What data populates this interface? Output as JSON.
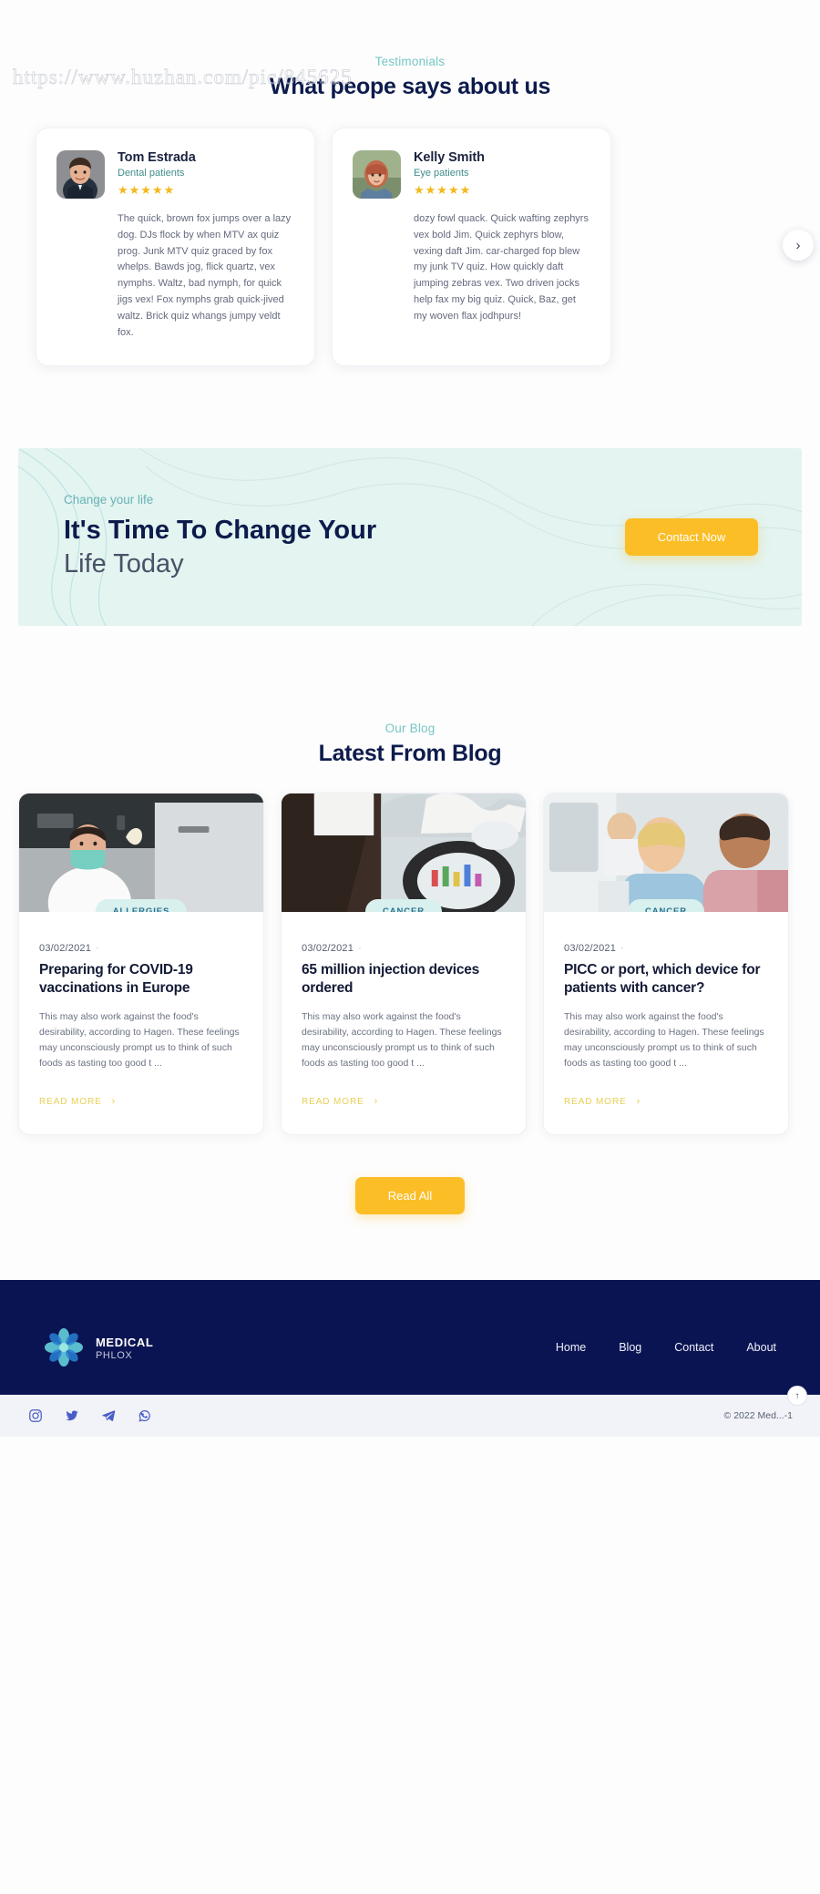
{
  "watermark": "https://www.huzhan.com/pic/845625",
  "testimonials": {
    "eyebrow": "Testimonials",
    "title": "What peope says about us",
    "next_label": "›",
    "cards": [
      {
        "name": "Tom Estrada",
        "role": "Dental patients",
        "stars": "★★★★★",
        "text": "The quick, brown fox jumps over a lazy dog. DJs flock by when MTV ax quiz prog. Junk MTV quiz graced by fox whelps. Bawds jog, flick quartz, vex nymphs. Waltz, bad nymph, for quick jigs vex! Fox nymphs grab quick-jived waltz. Brick quiz whangs jumpy veldt fox."
      },
      {
        "name": "Kelly Smith",
        "role": "Eye patients",
        "stars": "★★★★★",
        "text": "dozy fowl quack. Quick wafting zephyrs vex bold Jim. Quick zephyrs blow, vexing daft Jim. car-charged fop blew my junk TV quiz. How quickly daft jumping zebras vex. Two driven jocks help fax my big quiz. Quick, Baz, get my woven flax jodhpurs!"
      }
    ]
  },
  "cta": {
    "eyebrow": "Change your life",
    "title_strong": "It's Time To Change Your",
    "title_light": "Life Today",
    "button": "Contact Now",
    "bg_color": "#e3f4f1",
    "accent_color": "#fbbe26"
  },
  "blog": {
    "eyebrow": "Our Blog",
    "title": "Latest From Blog",
    "read_all": "Read All",
    "read_more": "READ MORE",
    "chevron": "›",
    "posts": [
      {
        "category": "ALLERGIES",
        "date": "03/02/2021",
        "title": "Preparing for COVID-19 vaccinations in Europe",
        "excerpt": "This may also work against the food's desirability, according to Hagen. These feelings may unconsciously prompt us to think of such foods as tasting too good t ..."
      },
      {
        "category": "CANCER",
        "date": "03/02/2021",
        "title": "65 million injection devices ordered",
        "excerpt": "This may also work against the food's desirability, according to Hagen. These feelings may unconsciously prompt us to think of such foods as tasting too good t ..."
      },
      {
        "category": "CANCER",
        "date": "03/02/2021",
        "title": "PICC or port, which device for patients with cancer?",
        "excerpt": "This may also work against the food's desirability, according to Hagen. These feelings may unconsciously prompt us to think of such foods as tasting too good t ..."
      }
    ]
  },
  "footer": {
    "brand_name": "MEDICAL",
    "brand_sub": "PHLOX",
    "nav": [
      {
        "label": "Home"
      },
      {
        "label": "Blog"
      },
      {
        "label": "Contact"
      },
      {
        "label": "About"
      }
    ],
    "social": [
      {
        "name": "instagram-icon"
      },
      {
        "name": "twitter-icon"
      },
      {
        "name": "telegram-icon"
      },
      {
        "name": "whatsapp-icon"
      }
    ],
    "copyright": "© 2022 Med...-1",
    "scroll_top": "↑",
    "bg_color": "#0b1452"
  }
}
